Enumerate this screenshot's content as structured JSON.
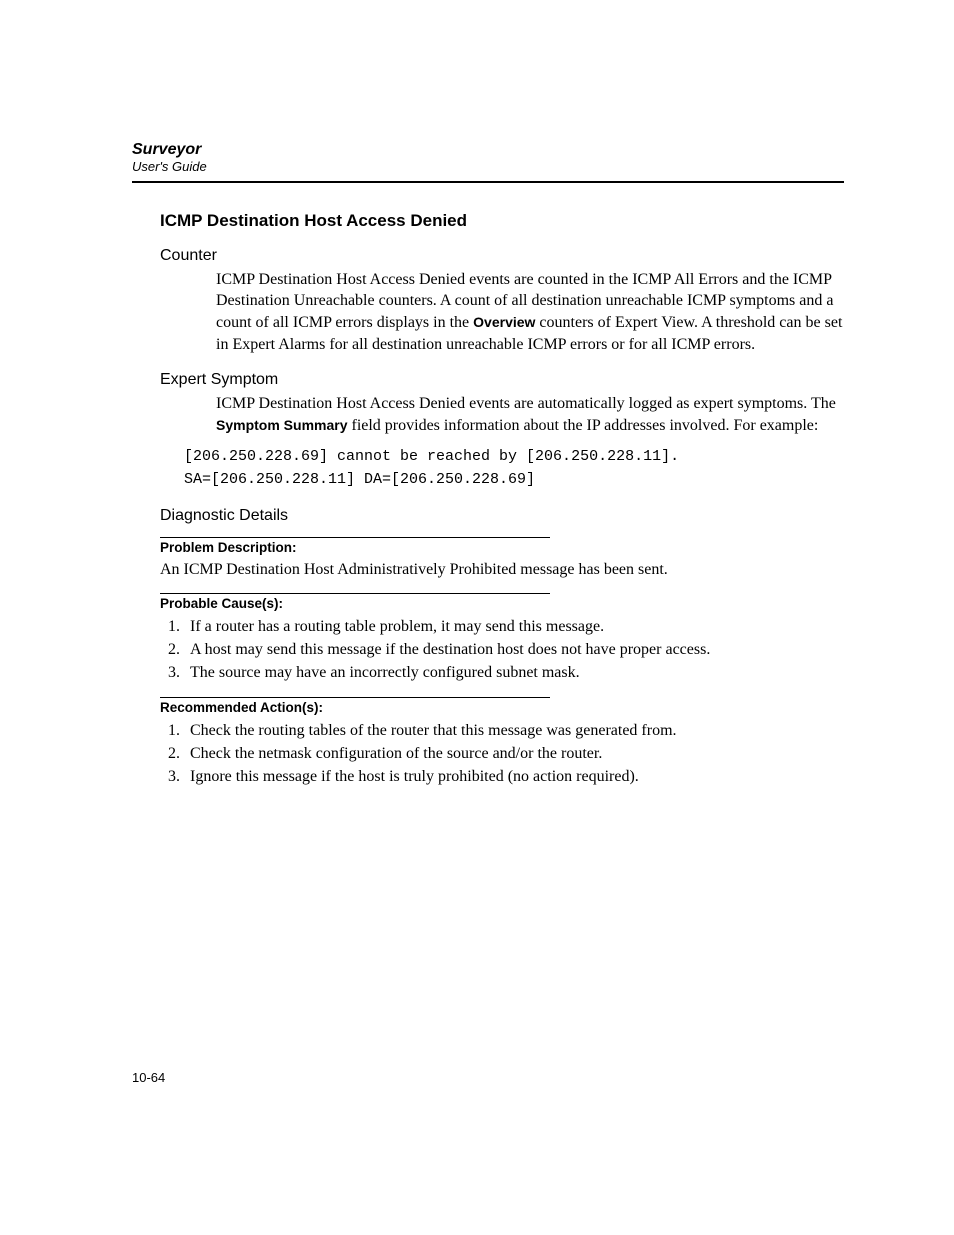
{
  "header": {
    "doc_title": "Surveyor",
    "doc_subtitle": "User's Guide"
  },
  "section": {
    "title": "ICMP Destination Host Access Denied",
    "counter": {
      "heading": "Counter",
      "text_pre": "ICMP Destination Host Access Denied events are counted in the ICMP All Errors and the ICMP Destination Unreachable counters. A count of all destination unreachable ICMP symptoms and a count of all ICMP errors displays in the ",
      "bold": "Overview",
      "text_post": " counters of Expert View. A threshold can be set in Expert Alarms for all destination unreachable ICMP errors or for all ICMP errors."
    },
    "expert": {
      "heading": "Expert Symptom",
      "text_pre": "ICMP Destination Host Access Denied events are automatically logged as expert symptoms. The ",
      "bold": "Symptom Summary",
      "text_post": " field provides information about the IP addresses involved. For example:",
      "code": "[206.250.228.69] cannot be reached by [206.250.228.11].\nSA=[206.250.228.11] DA=[206.250.228.69]"
    },
    "diagnostic": {
      "heading": "Diagnostic Details",
      "problem_label": "Problem Description:",
      "problem_text": "An ICMP Destination Host Administratively Prohibited message has been sent.",
      "causes_label": "Probable Cause(s):",
      "causes": [
        "If a router has a routing table problem, it may send this message.",
        "A host may send this message if the destination host does not have proper access.",
        "The source may have an incorrectly configured subnet mask."
      ],
      "actions_label": "Recommended Action(s):",
      "actions": [
        "Check the routing tables of the router that this message was generated from.",
        "Check the netmask configuration of the source and/or the router.",
        "Ignore this message if the host is truly prohibited (no action required)."
      ]
    }
  },
  "footer": {
    "page_number": "10-64"
  }
}
